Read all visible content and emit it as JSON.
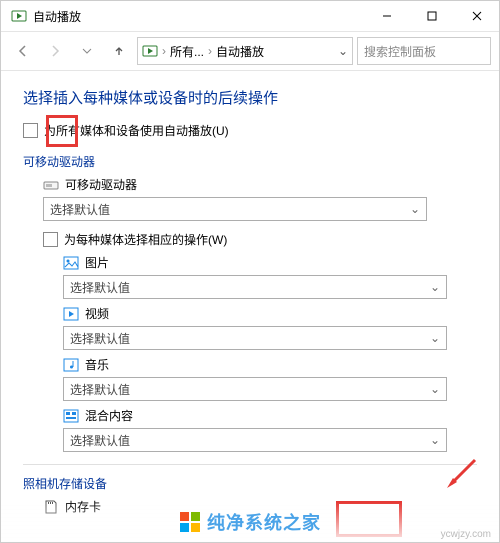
{
  "window": {
    "title": "自动播放"
  },
  "nav": {
    "crumb1": "所有...",
    "crumb2": "自动播放",
    "search_placeholder": "搜索控制面板"
  },
  "page": {
    "heading": "选择插入每种媒体或设备时的后续操作",
    "master_checkbox": "为所有媒体和设备使用自动播放(U)"
  },
  "sections": {
    "removable": "可移动驱动器",
    "per_media_label": "为每种媒体选择相应的操作(W)",
    "camera": "照相机存储设备"
  },
  "items": {
    "removable_drive": "可移动驱动器",
    "pictures": "图片",
    "videos": "视频",
    "music": "音乐",
    "mixed": "混合内容",
    "memory_card": "内存卡"
  },
  "select_default": "选择默认值",
  "watermark": {
    "text": "纯净系统之家",
    "url": "ycwjzy.com"
  }
}
